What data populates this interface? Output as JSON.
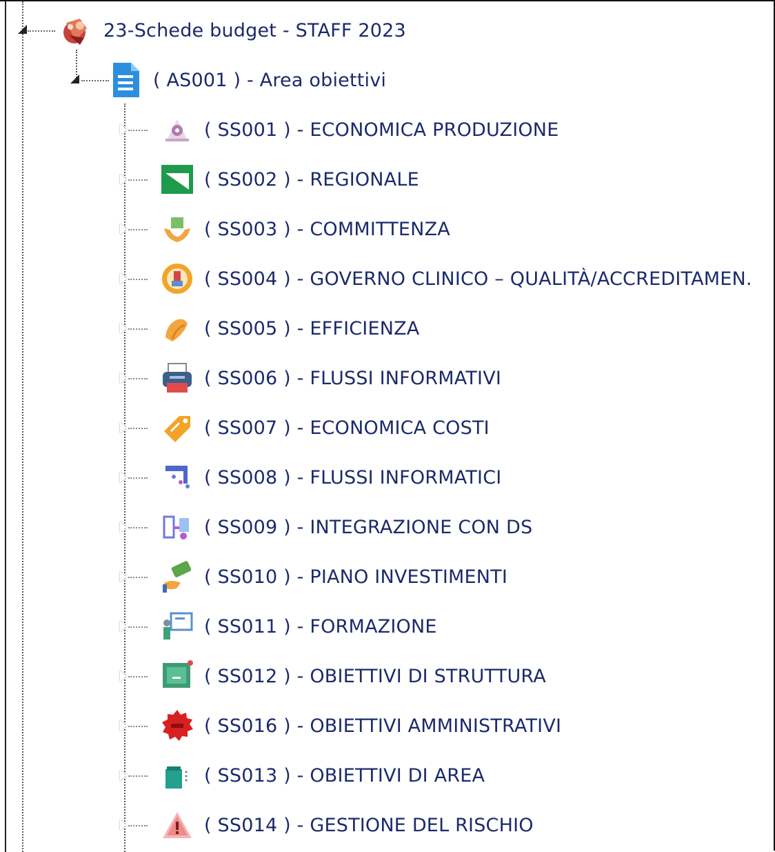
{
  "tree": {
    "root": {
      "label": "23-Schede budget - STAFF 2023",
      "icon": "budget-sheet-icon"
    },
    "area": {
      "label": "( AS001 ) - Area obiettivi",
      "icon": "document-icon"
    },
    "items": [
      {
        "label": "( SS001 ) - ECONOMICA PRODUZIONE",
        "icon": "scale-icon"
      },
      {
        "label": "( SS002 ) - REGIONALE",
        "icon": "green-flag-icon"
      },
      {
        "label": "( SS003 ) - COMMITTENZA",
        "icon": "hands-holding-box-icon"
      },
      {
        "label": "( SS004 ) - GOVERNO CLINICO – QUALITÀ/ACCREDITAMEN.",
        "icon": "badge-icon"
      },
      {
        "label": "( SS005 ) - EFFICIENZA",
        "icon": "clapping-hands-icon"
      },
      {
        "label": "( SS006 ) - FLUSSI INFORMATIVI",
        "icon": "printer-icon"
      },
      {
        "label": "( SS007 ) - ECONOMICA COSTI",
        "icon": "price-tag-icon"
      },
      {
        "label": "( SS008 ) - FLUSSI INFORMATICI",
        "icon": "network-icon"
      },
      {
        "label": "( SS009 ) - INTEGRAZIONE CON DS",
        "icon": "integration-icon"
      },
      {
        "label": "( SS010 ) - PIANO INVESTIMENTI",
        "icon": "money-hand-icon"
      },
      {
        "label": "( SS011 ) - FORMAZIONE",
        "icon": "presentation-board-icon"
      },
      {
        "label": "( SS012 ) - OBIETTIVI DI STRUTTURA",
        "icon": "structure-board-icon"
      },
      {
        "label": "( SS016 ) - OBIETTIVI AMMINISTRATIVI",
        "icon": "red-seal-icon"
      },
      {
        "label": "( SS013 ) - OBIETTIVI DI AREA",
        "icon": "area-box-icon"
      },
      {
        "label": "( SS014 ) - GESTIONE DEL RISCHIO",
        "icon": "warning-icon"
      }
    ]
  },
  "colors": {
    "label": "#1b2a6b",
    "connector": "#555555"
  }
}
